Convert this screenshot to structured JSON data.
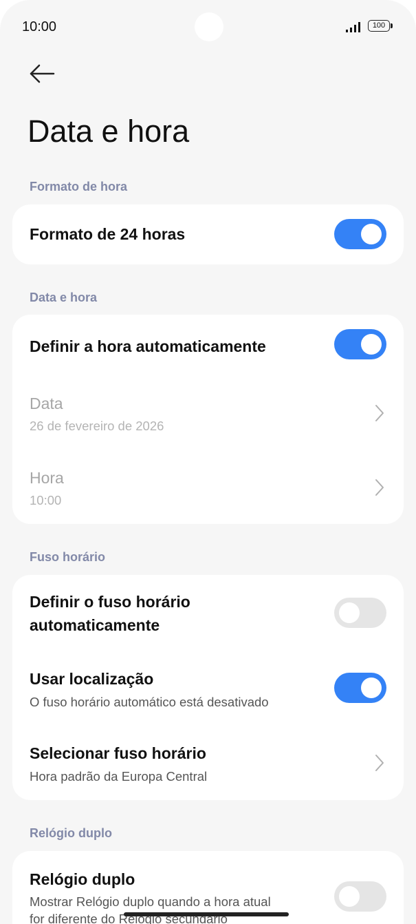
{
  "status_bar": {
    "time": "10:00",
    "battery": "100"
  },
  "page": {
    "title": "Data e hora"
  },
  "sections": {
    "time_format": {
      "label": "Formato de hora",
      "items": [
        {
          "title": "Formato de 24 horas",
          "toggle": "on"
        }
      ]
    },
    "date_time": {
      "label": "Data e hora",
      "items": [
        {
          "title": "Definir a hora automaticamente",
          "toggle": "on"
        },
        {
          "title": "Data",
          "subtitle": "26 de fevereiro de 2026",
          "disabled": true
        },
        {
          "title": "Hora",
          "subtitle": "10:00",
          "disabled": true
        }
      ]
    },
    "time_zone": {
      "label": "Fuso horário",
      "items": [
        {
          "title_line1": "Definir o fuso horário",
          "title_line2": "automaticamente",
          "toggle": "off"
        },
        {
          "title": "Usar localização",
          "subtitle": "O fuso horário automático está desativado",
          "toggle": "on"
        },
        {
          "title": "Selecionar fuso horário",
          "subtitle": "Hora padrão da Europa Central"
        }
      ]
    },
    "dual_clock": {
      "label": "Relógio duplo",
      "items": [
        {
          "title": "Relógio duplo",
          "subtitle_line1": "Mostrar Relógio duplo quando a hora atual",
          "subtitle_line2": "for diferente do Relógio secundário",
          "toggle": "off"
        }
      ]
    }
  },
  "colors": {
    "accent": "#3482f6",
    "section_label": "#8289a8",
    "background": "#f6f6f6"
  }
}
